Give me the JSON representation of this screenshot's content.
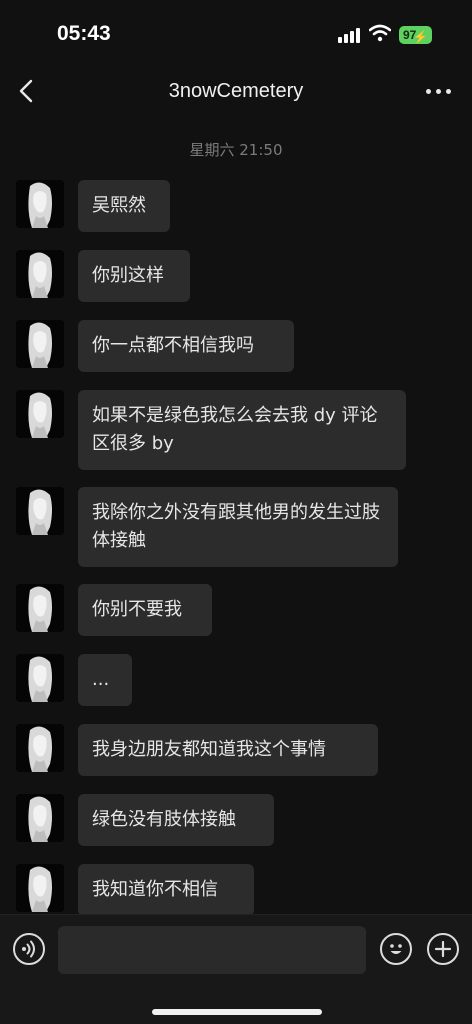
{
  "status_bar": {
    "time": "05:43",
    "battery": "97"
  },
  "header": {
    "title": "3nowCemetery"
  },
  "timestamp": "星期六 21:50",
  "messages": [
    {
      "text": "吴熙然"
    },
    {
      "text": "你别这样"
    },
    {
      "text": "你一点都不相信我吗"
    },
    {
      "text": "如果不是绿色我怎么会去我 dy 评论区很多 by"
    },
    {
      "text": "我除你之外没有跟其他男的发生过肢体接触"
    },
    {
      "text": "你别不要我"
    },
    {
      "text": "..."
    },
    {
      "text": "我身边朋友都知道我这个事情"
    },
    {
      "text": "绿色没有肢体接触"
    },
    {
      "text": "我知道你不相信"
    }
  ],
  "colors": {
    "battery": "#5fd160",
    "bubble": "#2c2c2c",
    "background": "#111111"
  },
  "icons": {
    "back": "chevron-left-icon",
    "more": "ellipsis-icon",
    "voice": "voice-icon",
    "emoji": "emoji-icon",
    "plus": "plus-icon"
  }
}
